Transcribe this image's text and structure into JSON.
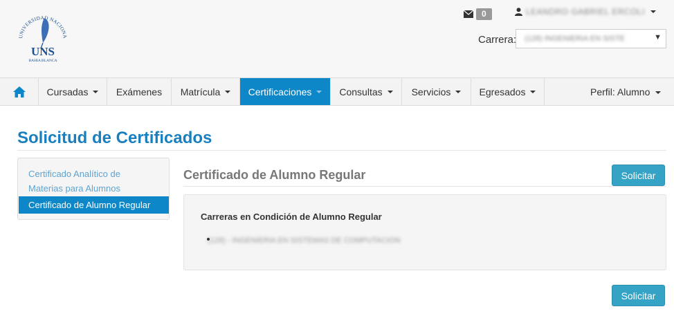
{
  "header": {
    "logo": {
      "text": "UNS",
      "ring_text": "UNIVERSIDAD NACIONAL DEL SUR",
      "subtitle": "BAHIA BLANCA"
    },
    "messages": {
      "icon": "envelope-icon",
      "count": "0"
    },
    "user": {
      "icon": "user-icon",
      "name": "LEANDRO GABRIEL ERCOLI"
    },
    "carrera": {
      "label": "Carrera:",
      "value": "(128) INGENIERIA EN SISTE"
    }
  },
  "nav": {
    "home_icon": "home-icon",
    "items": [
      {
        "label": "Cursadas"
      },
      {
        "label": "Exámenes"
      },
      {
        "label": "Matrícula"
      },
      {
        "label": "Certificaciones"
      },
      {
        "label": "Consultas"
      },
      {
        "label": "Servicios"
      },
      {
        "label": "Egresados"
      }
    ],
    "perfil": "Perfil: Alumno"
  },
  "page": {
    "title": "Solicitud de Certificados",
    "side_menu": [
      {
        "label": "Certificado Analítico de Materias para Alumnos"
      },
      {
        "label": "Certificado de Alumno Regular"
      }
    ],
    "section_title": "Certificado de Alumno Regular",
    "solicitar_label": "Solicitar",
    "panel": {
      "title": "Carreras en Condición de Alumno Regular",
      "items": [
        "(128) - INGENIERIA EN SISTEMAS DE COMPUTACION"
      ]
    }
  },
  "colors": {
    "accent": "#0e87c9",
    "button": "#35a3c6",
    "title": "#1a7fbf"
  }
}
